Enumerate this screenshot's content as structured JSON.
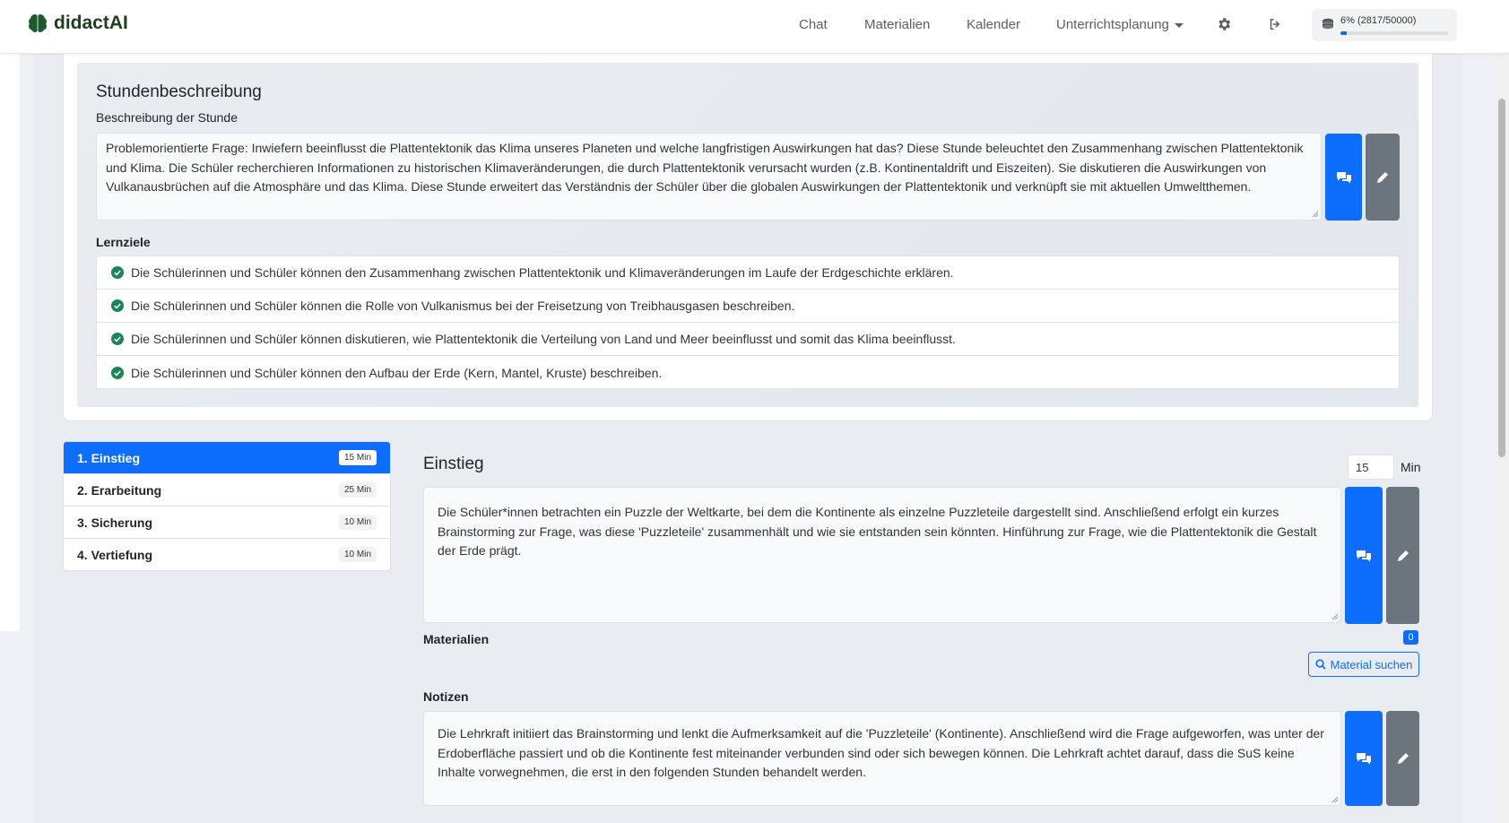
{
  "nav": {
    "brand": "didactAI",
    "links": [
      "Chat",
      "Materialien",
      "Kalender",
      "Unterrichtsplanung"
    ],
    "settings_icon": "gear-icon",
    "logout_icon": "logout-icon",
    "usage_text": "6% (2817/50000)",
    "usage_fraction": 0.06
  },
  "description": {
    "title": "Stundenbeschreibung",
    "label": "Beschreibung der Stunde",
    "text": "Problemorientierte Frage: Inwiefern beeinflusst die Plattentektonik das Klima unseres Planeten und welche langfristigen Auswirkungen hat das? Diese Stunde beleuchtet den Zusammenhang zwischen Plattentektonik und Klima. Die Schüler recherchieren Informationen zu historischen Klimaveränderungen, die durch Plattentektonik verursacht wurden (z.B. Kontinentaldrift und Eiszeiten). Sie diskutieren die Auswirkungen von Vulkanausbrüchen auf die Atmosphäre und das Klima. Diese Stunde erweitert das Verständnis der Schüler über die globalen Auswirkungen der Plattentektonik und verknüpft sie mit aktuellen Umweltthemen."
  },
  "goals": {
    "title": "Lernziele",
    "items": [
      "Die Schülerinnen und Schüler können den Zusammenhang zwischen Plattentektonik und Klimaveränderungen im Laufe der Erdgeschichte erklären.",
      "Die Schülerinnen und Schüler können die Rolle von Vulkanismus bei der Freisetzung von Treibhausgasen beschreiben.",
      "Die Schülerinnen und Schüler können diskutieren, wie Plattentektonik die Verteilung von Land und Meer beeinflusst und somit das Klima beeinflusst.",
      "Die Schülerinnen und Schüler können den Aufbau der Erde (Kern, Mantel, Kruste) beschreiben."
    ]
  },
  "phases": [
    {
      "label": "1. Einstieg",
      "duration": "15 Min",
      "active": true
    },
    {
      "label": "2. Erarbeitung",
      "duration": "25 Min",
      "active": false
    },
    {
      "label": "3. Sicherung",
      "duration": "10 Min",
      "active": false
    },
    {
      "label": "4. Vertiefung",
      "duration": "10 Min",
      "active": false
    }
  ],
  "detail": {
    "title": "Einstieg",
    "minutes_value": "15",
    "minutes_unit": "Min",
    "text": "Die Schüler*innen betrachten ein Puzzle der Weltkarte, bei dem die Kontinente als einzelne Puzzleteile dargestellt sind. Anschließend erfolgt ein kurzes Brainstorming zur Frage, was diese 'Puzzleteile' zusammenhält und wie sie entstanden sein könnten. Hinführung zur Frage, wie die Plattentektonik die Gestalt der Erde prägt.",
    "materials_label": "Materialien",
    "materials_count": "0",
    "search_button": "Material suchen",
    "notes_label": "Notizen",
    "notes_text": "Die Lehrkraft initiiert das Brainstorming und lenkt die Aufmerksamkeit auf die 'Puzzleteile' (Kontinente). Anschließend wird die Frage aufgeworfen, was unter der Erdoberfläche passiert und ob die Kontinente fest miteinander verbunden sind oder sich bewegen können. Die Lehrkraft achtet darauf, dass die SuS keine Inhalte vorwegnehmen, die erst in den folgenden Stunden behandelt werden."
  },
  "colors": {
    "primary": "#0d6efd",
    "secondary": "#6c757d",
    "success": "#198754"
  }
}
